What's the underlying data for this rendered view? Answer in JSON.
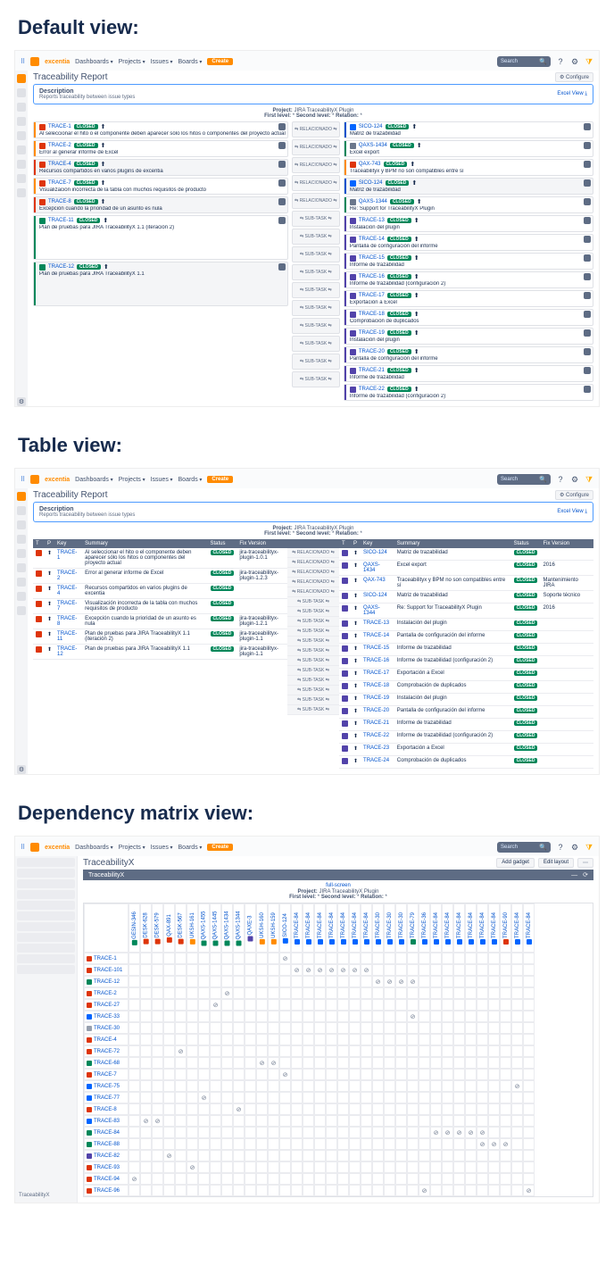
{
  "headings": {
    "default": "Default view:",
    "table": "Table view:",
    "matrix": "Dependency matrix view:"
  },
  "nav": {
    "brand": "excentia",
    "items": [
      "Dashboards",
      "Projects",
      "Issues",
      "Boards"
    ],
    "create": "Create",
    "search_placeholder": "Search"
  },
  "page": {
    "title_report": "Traceability Report",
    "title_x": "TraceabilityX",
    "configure": "Configure",
    "add_gadget": "Add gadget",
    "edit_layout": "Edit layout",
    "desc_head": "Description",
    "desc_sub": "Reports traceability between issue types",
    "excel": "Excel View",
    "full_screen": "full-screen",
    "gadget_title": "TraceabilityX",
    "sidebar_gadget": "TraceabilityX"
  },
  "meta": {
    "project_label": "Project:",
    "project": "JIRA TraceabilityX Plugin",
    "first_label": "First level:",
    "first": "*",
    "second_label": "Second level:",
    "second": "*",
    "relation_label": "Relation:",
    "relation": "*"
  },
  "relations": {
    "relacionado": "RELACIONADO",
    "subtask": "SUB-TASK"
  },
  "status": {
    "closed": "CLOSED"
  },
  "default_left": [
    {
      "key": "TRACE-1",
      "summary": "Al seleccionar el hito o el componente deben aparecer sólo los hitos o componentes del proyecto actual",
      "bar": "orange",
      "it": "it-red"
    },
    {
      "key": "TRACE-2",
      "summary": "Error al generar informe de Excel",
      "bar": "orange",
      "it": "it-red"
    },
    {
      "key": "TRACE-4",
      "summary": "Recursos compartidos en varios plugins de excentia",
      "bar": "red",
      "it": "it-red",
      "shaded": true
    },
    {
      "key": "TRACE-7",
      "summary": "Visualización incorrecta de la tabla con muchos requisitos de producto",
      "bar": "orange",
      "it": "it-red"
    },
    {
      "key": "TRACE-8",
      "summary": "Excepción cuando la prioridad de un asunto es nula",
      "bar": "red",
      "it": "it-red",
      "shaded": true
    },
    {
      "key": "TRACE-11",
      "summary": "Plan de pruebas para JIRA TraceabilityX 1.1 (iteración 2)",
      "bar": "green",
      "it": "it-green",
      "tall": true
    },
    {
      "key": "TRACE-12",
      "summary": "Plan de pruebas para JIRA TraceabilityX 1.1",
      "bar": "green",
      "it": "it-green",
      "tall": true,
      "shaded": true
    }
  ],
  "default_right": [
    {
      "key": "SICO-124",
      "summary": "Matriz de trazabilidad",
      "bar": "blue",
      "it": "it-blue",
      "rel": "relacionado"
    },
    {
      "key": "QAXS-1434",
      "summary": "Excel export",
      "bar": "green",
      "it": "it-grey",
      "rel": "relacionado"
    },
    {
      "key": "QAX-743",
      "summary": "Traceabilityx y BPM no son compatibles entre sí",
      "bar": "orange",
      "it": "it-red",
      "rel": "relacionado"
    },
    {
      "key": "SICO-124",
      "summary": "Matriz de trazabilidad",
      "bar": "blue",
      "it": "it-blue",
      "rel": "relacionado",
      "shaded": true
    },
    {
      "key": "QAXS-1344",
      "summary": "Re: Support for TraceabilityX Plugin",
      "bar": "green",
      "it": "it-grey",
      "rel": "relacionado"
    },
    {
      "key": "TRACE-13",
      "summary": "Instalación del plugin",
      "bar": "purple",
      "it": "it-purple",
      "rel": "subtask"
    },
    {
      "key": "TRACE-14",
      "summary": "Pantalla de configuración del informe",
      "bar": "purple",
      "it": "it-purple",
      "rel": "subtask"
    },
    {
      "key": "TRACE-15",
      "summary": "Informe de trazabilidad",
      "bar": "purple",
      "it": "it-purple",
      "rel": "subtask"
    },
    {
      "key": "TRACE-16",
      "summary": "Informe de trazabilidad (configuración 2)",
      "bar": "purple",
      "it": "it-purple",
      "rel": "subtask"
    },
    {
      "key": "TRACE-17",
      "summary": "Exportación a Excel",
      "bar": "purple",
      "it": "it-purple",
      "rel": "subtask"
    },
    {
      "key": "TRACE-18",
      "summary": "Comprobación de duplicados",
      "bar": "purple",
      "it": "it-purple",
      "rel": "subtask"
    },
    {
      "key": "TRACE-19",
      "summary": "Instalación del plugin",
      "bar": "purple",
      "it": "it-purple",
      "rel": "subtask"
    },
    {
      "key": "TRACE-20",
      "summary": "Pantalla de configuración del informe",
      "bar": "purple",
      "it": "it-purple",
      "rel": "subtask"
    },
    {
      "key": "TRACE-21",
      "summary": "Informe de trazabilidad",
      "bar": "purple",
      "it": "it-purple",
      "rel": "subtask"
    },
    {
      "key": "TRACE-22",
      "summary": "Informe de trazabilidad (configuración 2)",
      "bar": "purple",
      "it": "it-purple",
      "rel": "subtask"
    }
  ],
  "table_cols_left": [
    "T",
    "P",
    "Key",
    "Summary",
    "Status",
    "Fix Version"
  ],
  "table_cols_right": [
    "T",
    "P",
    "Key",
    "Summary",
    "Status",
    "Fix Version"
  ],
  "table_left": [
    {
      "key": "TRACE-1",
      "summary": "Al seleccionar el hito o el componente deben aparecer sólo los hitos o componentes del proyecto actual",
      "fix": "jira-traceabilityx-plugin-1.0.1",
      "rel": "RELACIONADO"
    },
    {
      "key": "TRACE-2",
      "summary": "Error al generar informe de Excel",
      "fix": "jira-traceabilityx-plugin-1.2.3",
      "rel": "RELACIONADO"
    },
    {
      "key": "TRACE-4",
      "summary": "Recursos compartidos en varios plugins de excentia",
      "fix": "",
      "rel": "RELACIONADO"
    },
    {
      "key": "TRACE-7",
      "summary": "Visualización incorrecta de la tabla con muchos requisitos de producto",
      "fix": "",
      "rel": "RELACIONADO"
    },
    {
      "key": "TRACE-8",
      "summary": "Excepción cuando la prioridad de un asunto es nula",
      "fix": "jira-traceabilityx-plugin-1.2.1",
      "rel": "RELACIONADO"
    },
    {
      "key": "TRACE-11",
      "summary": "Plan de pruebas para JIRA TraceabilityX 1.1 (iteración 2)",
      "fix": "jira-traceabilityx-plugin-1.1",
      "rel": "SUB-TASK",
      "span": 6
    },
    {
      "key": "TRACE-12",
      "summary": "Plan de pruebas para JIRA TraceabilityX 1.1",
      "fix": "jira-traceabilityx-plugin-1.1",
      "rel": "SUB-TASK",
      "span": 6
    }
  ],
  "table_right": [
    {
      "key": "SICO-124",
      "summary": "Matriz de trazabilidad",
      "fix": ""
    },
    {
      "key": "QAXS-1434",
      "summary": "Excel export",
      "fix": "2016"
    },
    {
      "key": "QAX-743",
      "summary": "Traceabilityx y BPM no son compatibles entre sí",
      "fix": "Mantenimiento JIRA"
    },
    {
      "key": "SICO-124",
      "summary": "Matriz de trazabilidad",
      "fix": "Soporte técnico"
    },
    {
      "key": "QAXS-1344",
      "summary": "Re: Support for TraceabilityX Plugin",
      "fix": "2016"
    },
    {
      "key": "TRACE-13",
      "summary": "Instalación del plugin",
      "fix": ""
    },
    {
      "key": "TRACE-14",
      "summary": "Pantalla de configuración del informe",
      "fix": ""
    },
    {
      "key": "TRACE-15",
      "summary": "Informe de trazabilidad",
      "fix": ""
    },
    {
      "key": "TRACE-16",
      "summary": "Informe de trazabilidad (configuración 2)",
      "fix": ""
    },
    {
      "key": "TRACE-17",
      "summary": "Exportación a Excel",
      "fix": ""
    },
    {
      "key": "TRACE-18",
      "summary": "Comprobación de duplicados",
      "fix": ""
    },
    {
      "key": "TRACE-19",
      "summary": "Instalación del plugin",
      "fix": ""
    },
    {
      "key": "TRACE-20",
      "summary": "Pantalla de configuración del informe",
      "fix": ""
    },
    {
      "key": "TRACE-21",
      "summary": "Informe de trazabilidad",
      "fix": ""
    },
    {
      "key": "TRACE-22",
      "summary": "Informe de trazabilidad (configuración 2)",
      "fix": ""
    },
    {
      "key": "TRACE-23",
      "summary": "Exportación a Excel",
      "fix": ""
    },
    {
      "key": "TRACE-24",
      "summary": "Comprobación de duplicados",
      "fix": ""
    }
  ],
  "matrix": {
    "cols": [
      {
        "k": "GESIN-346",
        "c": "b-green"
      },
      {
        "k": "DESK-628",
        "c": "b-red"
      },
      {
        "k": "DESK-579",
        "c": "b-red"
      },
      {
        "k": "QAX-891",
        "c": "b-red"
      },
      {
        "k": "DESK-567",
        "c": "b-red"
      },
      {
        "k": "UKSH-161",
        "c": "b-orange"
      },
      {
        "k": "QAXS-1455",
        "c": "b-green"
      },
      {
        "k": "QAXS-1445",
        "c": "b-green"
      },
      {
        "k": "QAXS-1434",
        "c": "b-green"
      },
      {
        "k": "QAXS-1344",
        "c": "b-green"
      },
      {
        "k": "QAXE-3",
        "c": "b-purple"
      },
      {
        "k": "UKSH-160",
        "c": "b-orange"
      },
      {
        "k": "UKSH-159",
        "c": "b-orange"
      },
      {
        "k": "SICO-124",
        "c": "b-blue"
      },
      {
        "k": "TRACE-84",
        "c": "b-blue"
      },
      {
        "k": "TRACE-84",
        "c": "b-blue"
      },
      {
        "k": "TRACE-84",
        "c": "b-blue"
      },
      {
        "k": "TRACE-84",
        "c": "b-blue"
      },
      {
        "k": "TRACE-84",
        "c": "b-blue"
      },
      {
        "k": "TRACE-84",
        "c": "b-blue"
      },
      {
        "k": "TRACE-84",
        "c": "b-blue"
      },
      {
        "k": "TRACE-30",
        "c": "b-blue"
      },
      {
        "k": "TRACE-30",
        "c": "b-blue"
      },
      {
        "k": "TRACE-30",
        "c": "b-blue"
      },
      {
        "k": "TRACE-79",
        "c": "b-green"
      },
      {
        "k": "TRACE-36",
        "c": "b-blue"
      },
      {
        "k": "TRACE-84",
        "c": "b-blue"
      },
      {
        "k": "TRACE-84",
        "c": "b-blue"
      },
      {
        "k": "TRACE-84",
        "c": "b-blue"
      },
      {
        "k": "TRACE-84",
        "c": "b-blue"
      },
      {
        "k": "TRACE-84",
        "c": "b-blue"
      },
      {
        "k": "TRACE-84",
        "c": "b-blue"
      },
      {
        "k": "TRACE-90",
        "c": "b-red"
      },
      {
        "k": "TRACE-84",
        "c": "b-blue"
      },
      {
        "k": "TRACE-84",
        "c": "b-blue"
      }
    ],
    "rows": [
      {
        "k": "TRACE-1",
        "c": "b-red",
        "marks": [
          13
        ]
      },
      {
        "k": "TRACE-101",
        "c": "b-red",
        "marks": [
          14,
          15,
          16,
          17,
          18,
          19,
          20
        ]
      },
      {
        "k": "TRACE-12",
        "c": "b-green",
        "marks": [
          21,
          22,
          23,
          24
        ]
      },
      {
        "k": "TRACE-2",
        "c": "b-red",
        "marks": [
          8
        ]
      },
      {
        "k": "TRACE-27",
        "c": "b-red",
        "marks": [
          7
        ]
      },
      {
        "k": "TRACE-33",
        "c": "b-blue",
        "marks": [
          24
        ]
      },
      {
        "k": "TRACE-30",
        "c": "b-grey",
        "marks": []
      },
      {
        "k": "TRACE-4",
        "c": "b-red",
        "marks": []
      },
      {
        "k": "TRACE-72",
        "c": "b-red",
        "marks": [
          4
        ]
      },
      {
        "k": "TRACE-68",
        "c": "b-green",
        "marks": [
          11,
          12
        ]
      },
      {
        "k": "TRACE-7",
        "c": "b-red",
        "marks": [
          13
        ]
      },
      {
        "k": "TRACE-75",
        "c": "b-blue",
        "marks": [
          33
        ]
      },
      {
        "k": "TRACE-77",
        "c": "b-blue",
        "marks": [
          6
        ]
      },
      {
        "k": "TRACE-8",
        "c": "b-red",
        "marks": [
          9
        ]
      },
      {
        "k": "TRACE-83",
        "c": "b-blue",
        "marks": [
          1,
          2
        ]
      },
      {
        "k": "TRACE-84",
        "c": "b-green",
        "marks": [
          26,
          27,
          28,
          29,
          30
        ]
      },
      {
        "k": "TRACE-88",
        "c": "b-green",
        "marks": [
          30,
          31,
          32
        ]
      },
      {
        "k": "TRACE-82",
        "c": "b-purple",
        "marks": [
          3
        ]
      },
      {
        "k": "TRACE-93",
        "c": "b-red",
        "marks": [
          5
        ]
      },
      {
        "k": "TRACE-94",
        "c": "b-red",
        "marks": [
          0
        ]
      },
      {
        "k": "TRACE-96",
        "c": "b-red",
        "marks": [
          25,
          34
        ]
      }
    ]
  }
}
